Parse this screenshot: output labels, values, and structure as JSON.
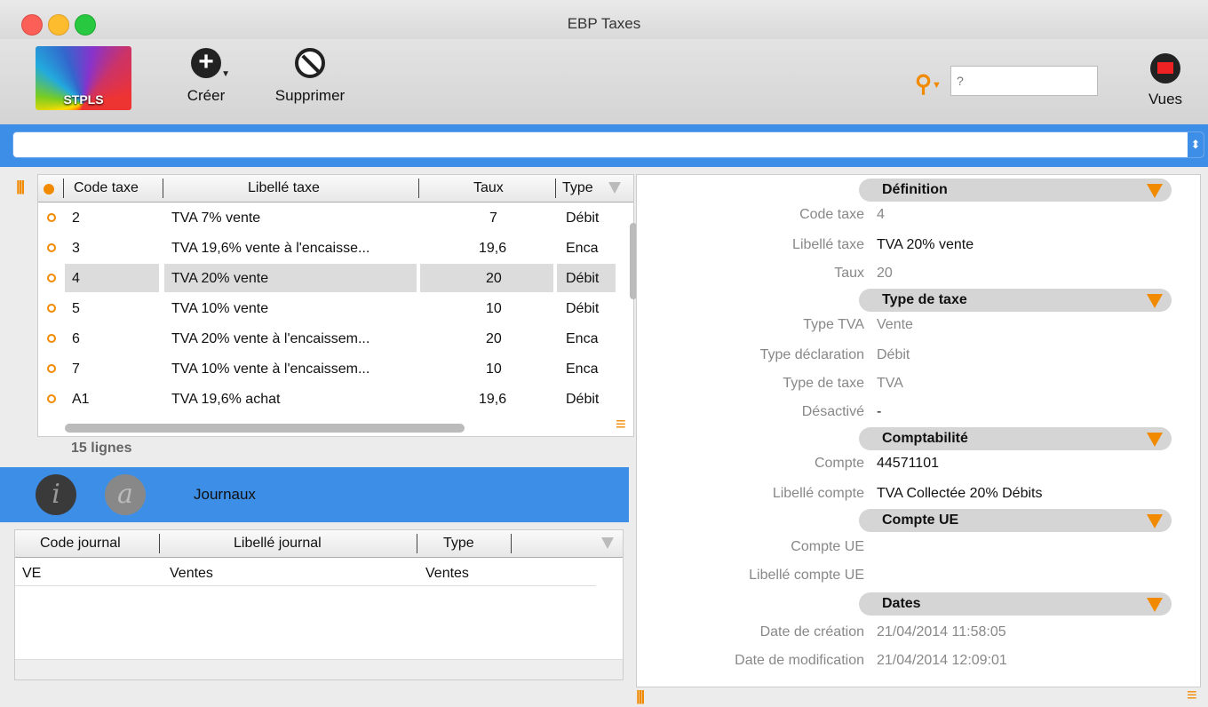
{
  "window": {
    "title": "EBP Taxes"
  },
  "toolbar": {
    "logo_text": "STPLS",
    "create_label": "Créer",
    "delete_label": "Supprimer",
    "search_placeholder": "?",
    "views_label": "Vues"
  },
  "filter_bar": {
    "value": ""
  },
  "taxes_table": {
    "columns": [
      "Code taxe",
      "Libellé taxe",
      "Taux",
      "Type"
    ],
    "rows": [
      {
        "code": "2",
        "label": "TVA 7% vente",
        "rate": "7",
        "type": "Débit"
      },
      {
        "code": "3",
        "label": "TVA 19,6% vente à l'encaisse...",
        "rate": "19,6",
        "type": "Enca"
      },
      {
        "code": "4",
        "label": "TVA 20% vente",
        "rate": "20",
        "type": "Débit"
      },
      {
        "code": "5",
        "label": "TVA 10% vente",
        "rate": "10",
        "type": "Débit"
      },
      {
        "code": "6",
        "label": "TVA 20% vente à l'encaissem...",
        "rate": "20",
        "type": "Enca"
      },
      {
        "code": "7",
        "label": "TVA 10% vente à l'encaissem...",
        "rate": "10",
        "type": "Enca"
      },
      {
        "code": "A1",
        "label": "TVA 19,6% achat",
        "rate": "19,6",
        "type": "Débit"
      }
    ],
    "selected_code": "4",
    "line_count": "15 lignes"
  },
  "info_bar": {
    "journals_label": "Journaux",
    "info_icon": "i",
    "at_icon": "a"
  },
  "journals_table": {
    "columns": [
      "Code journal",
      "Libellé journal",
      "Type"
    ],
    "rows": [
      {
        "code": "VE",
        "label": "Ventes",
        "type": "Ventes"
      }
    ]
  },
  "detail": {
    "sections": {
      "definition": "Définition",
      "tax_type": "Type de taxe",
      "accounting": "Comptabilité",
      "eu_account": "Compte UE",
      "dates": "Dates"
    },
    "fields": {
      "code_label": "Code taxe",
      "code_value": "4",
      "label_label": "Libellé taxe",
      "label_value": "TVA 20% vente",
      "rate_label": "Taux",
      "rate_value": "20",
      "vat_type_label": "Type TVA",
      "vat_type_value": "Vente",
      "declaration_label": "Type déclaration",
      "declaration_value": "Débit",
      "tax_kind_label": "Type de taxe",
      "tax_kind_value": "TVA",
      "disabled_label": "Désactivé",
      "disabled_value": "-",
      "account_label": "Compte",
      "account_value": "44571101",
      "account_name_label": "Libellé compte",
      "account_name_value": "TVA Collectée 20% Débits",
      "eu_account_label": "Compte UE",
      "eu_account_value": "",
      "eu_account_name_label": "Libellé compte UE",
      "eu_account_name_value": "",
      "created_label": "Date de création",
      "created_value": "21/04/2014 11:58:05",
      "modified_label": "Date de modification",
      "modified_value": "21/04/2014 12:09:01"
    }
  },
  "colors": {
    "accent": "#3d8ee7",
    "orange": "#f28a00"
  }
}
